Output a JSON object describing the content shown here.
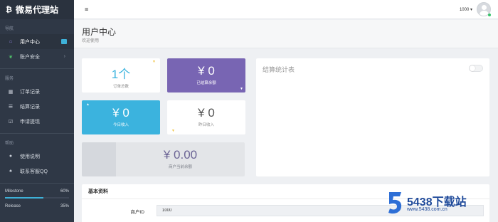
{
  "brand": {
    "icon": "₿",
    "title": "微易代理站"
  },
  "sidebar": {
    "sections": [
      {
        "label": "导航",
        "items": [
          {
            "label": "用户中心",
            "icon": "home-icon",
            "active": true,
            "badge": true
          },
          {
            "label": "账户安全",
            "icon": "leaf-icon",
            "chevron": "›"
          }
        ]
      },
      {
        "label": "服务",
        "items": [
          {
            "label": "订单记录",
            "icon": "table-icon"
          },
          {
            "label": "结算记录",
            "icon": "list-icon"
          },
          {
            "label": "申请提现",
            "icon": "check-square-icon"
          }
        ]
      },
      {
        "label": "帮助",
        "items": [
          {
            "label": "使用说明",
            "icon": "info-circle-icon"
          },
          {
            "label": "联系客服QQ",
            "icon": "bell-icon"
          }
        ]
      }
    ],
    "progress": [
      {
        "label": "Milestone",
        "value": "60%",
        "fraction": 0.6
      },
      {
        "label": "Release",
        "value": "35%",
        "fraction": 0.35
      }
    ]
  },
  "topbar": {
    "menu_icon": "≡",
    "username": "1000 ▾"
  },
  "header": {
    "title": "用户中心",
    "subtitle": "欢迎使用"
  },
  "cards": {
    "orders": {
      "value": "1个",
      "label": "订单总数"
    },
    "settled": {
      "value": "¥ 0",
      "label": "已结算余额"
    },
    "today": {
      "value": "¥ 0",
      "label": "今日收入"
    },
    "yesterday": {
      "value": "¥ 0",
      "label": "昨日收入"
    },
    "balance": {
      "value": "¥ 0.00",
      "label": "商户当前余额"
    }
  },
  "stats": {
    "title": "结算统计表"
  },
  "info": {
    "title": "基本资料",
    "merchant_id_label": "商户ID",
    "merchant_id_value": "1000"
  },
  "watermark": {
    "text": "5438下载站",
    "url": "www.5438.com.cn"
  },
  "colors": {
    "sidebar": "#2f3846",
    "purple": "#7865b3",
    "blue": "#3bb3de",
    "accent": "#3eb1d8"
  }
}
